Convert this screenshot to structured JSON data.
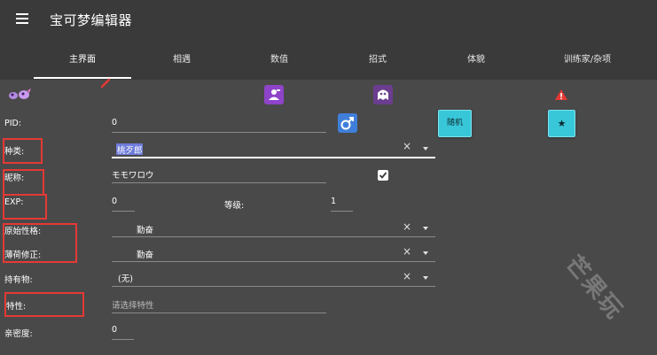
{
  "app": {
    "title": "宝可梦编辑器"
  },
  "tabs": [
    {
      "label": "主界面",
      "active": true
    },
    {
      "label": "相遇"
    },
    {
      "label": "数值"
    },
    {
      "label": "招式"
    },
    {
      "label": "体貌"
    },
    {
      "label": "训练家/杂项"
    }
  ],
  "icons": {
    "menu": "menu-icon",
    "pokemon_sprite": "pokemon-sprite-icon",
    "edit_mark": "red-edit-mark-icon",
    "trainer": "trainer-card-icon",
    "ghost": "ghost-icon",
    "warning": "warning-icon",
    "gender": "male-icon"
  },
  "fields": {
    "pid": {
      "label": "PID:",
      "value": "0"
    },
    "species": {
      "label": "种类:",
      "value": "桃歹郎"
    },
    "nickname": {
      "label": "昵称:",
      "value": "モモワロウ",
      "checked": true
    },
    "exp": {
      "label": "EXP:",
      "value": "0"
    },
    "level": {
      "label": "等级:",
      "value": "1"
    },
    "nature": {
      "label": "原始性格:",
      "value": "勤奋"
    },
    "mint_nature": {
      "label": "薄荷修正:",
      "value": "勤奋"
    },
    "held_item": {
      "label": "持有物:",
      "value": "(无)"
    },
    "ability": {
      "label": "特性:",
      "placeholder": "请选择特性"
    },
    "friendship": {
      "label": "亲密度:",
      "value": "0"
    }
  },
  "buttons": {
    "shiny": "★",
    "random": "随机"
  },
  "watermark": "芒果玩",
  "colors": {
    "background": "#494949",
    "appbar": "#3a3a3a",
    "accent_cyan": "#38c7d8",
    "annotation_red": "#e53935",
    "gender_blue": "#3f7fd9"
  }
}
